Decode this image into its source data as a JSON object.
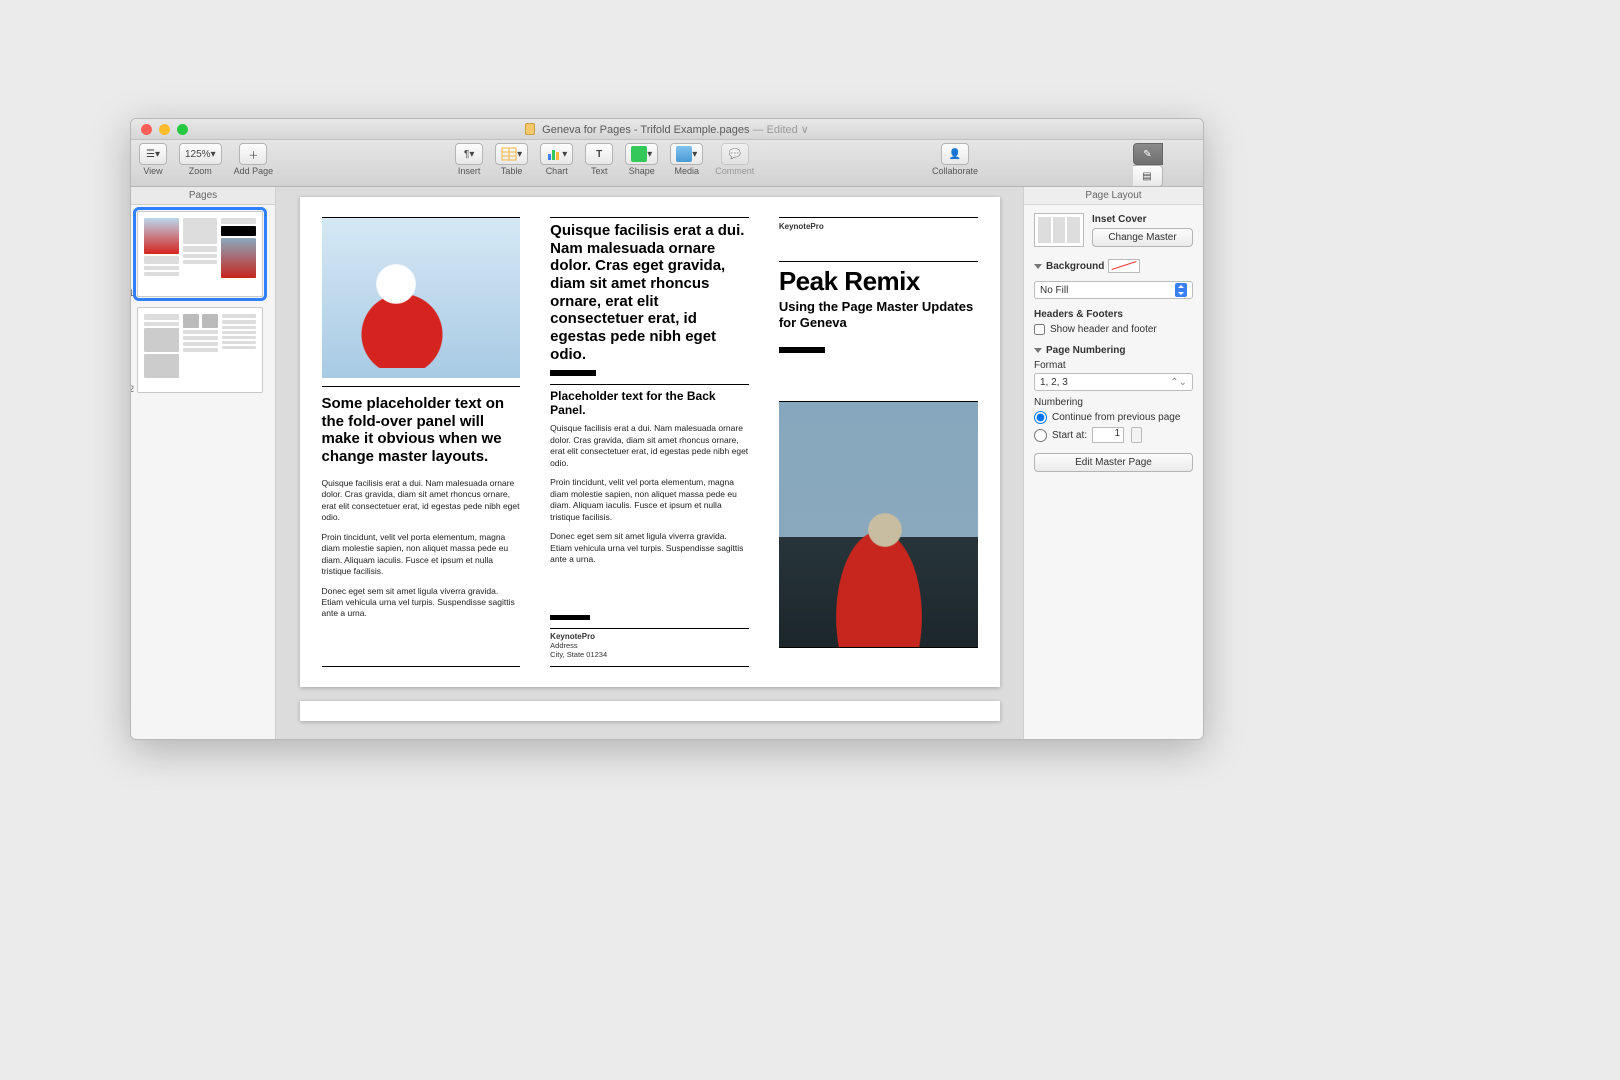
{
  "titlebar": {
    "document_name": "Geneva for Pages - Trifold Example.pages",
    "edited_suffix": " — Edited ∨"
  },
  "toolbar": {
    "view_label": "View",
    "zoom_value": "125%",
    "zoom_label": "Zoom",
    "add_page_label": "Add Page",
    "insert_label": "Insert",
    "table_label": "Table",
    "chart_label": "Chart",
    "text_label": "Text",
    "shape_label": "Shape",
    "media_label": "Media",
    "comment_label": "Comment",
    "collaborate_label": "Collaborate",
    "format_label": "Format",
    "document_label": "Document"
  },
  "sidebar": {
    "title": "Pages",
    "pages": [
      {
        "num": "1"
      },
      {
        "num": "2"
      }
    ]
  },
  "doc": {
    "panel1": {
      "heading": "Some placeholder text on the fold-over panel will make it obvious when we change master layouts.",
      "p1": "Quisque facilisis erat a dui. Nam malesuada ornare dolor. Cras gravida, diam sit amet rhoncus ornare, erat elit consectetuer erat, id egestas pede nibh eget odio.",
      "p2": "Proin tincidunt, velit vel porta elementum, magna diam molestie sapien, non aliquet massa pede eu diam. Aliquam iaculis. Fusce et ipsum et nulla tristique facilisis.",
      "p3": "Donec eget sem sit amet ligula viverra gravida. Etiam vehicula urna vel turpis. Suspendisse sagittis ante a urna."
    },
    "panel2": {
      "big": "Quisque facilisis erat a dui. Nam malesuada ornare dolor. Cras eget gravida, diam sit amet rhoncus ornare, erat elit consectetuer erat, id egestas pede nibh eget odio.",
      "sub": "Placeholder text for the Back Panel.",
      "p1": "Quisque facilisis erat a dui. Nam malesuada ornare dolor. Cras gravida, diam sit amet rhoncus ornare, erat elit consectetuer erat, id egestas pede nibh eget odio.",
      "p2": "Proin tincidunt, velit vel porta elementum, magna diam molestie sapien, non aliquet massa pede eu diam. Aliquam iaculis. Fusce et ipsum et nulla tristique facilisis.",
      "p3": "Donec eget sem sit amet ligula viverra gravida. Etiam vehicula urna vel turpis. Suspendisse sagittis ante a urna.",
      "brand": "KeynotePro",
      "addr1": "Address",
      "addr2": "City, State 01234"
    },
    "panel3": {
      "brand": "KeynotePro",
      "title": "Peak Remix",
      "sub": "Using the Page Master Updates for Geneva"
    }
  },
  "inspector": {
    "title": "Page Layout",
    "master_name": "Inset Cover",
    "change_master": "Change Master",
    "background_label": "Background",
    "fill_value": "No Fill",
    "headers_label": "Headers & Footers",
    "show_hf_label": "Show header and footer",
    "page_numbering_label": "Page Numbering",
    "format_label": "Format",
    "format_value": "1, 2, 3",
    "numbering_label": "Numbering",
    "continue_label": "Continue from previous page",
    "start_at_label": "Start at:",
    "start_at_value": "1",
    "edit_master_label": "Edit Master Page"
  }
}
